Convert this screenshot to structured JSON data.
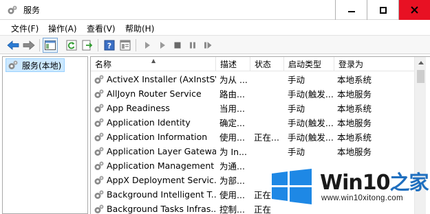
{
  "window": {
    "title": "服务",
    "accent": "#e81123"
  },
  "menu": [
    {
      "label": "文件(F)"
    },
    {
      "label": "操作(A)"
    },
    {
      "label": "查看(V)"
    },
    {
      "label": "帮助(H)"
    }
  ],
  "toolbar": {
    "icons": [
      "back-arrow-icon",
      "forward-arrow-icon",
      "show-console-tree-icon",
      "refresh-icon",
      "export-list-icon",
      "help-icon",
      "properties-icon",
      "start-service-icon",
      "start-service-alt-icon",
      "stop-service-icon",
      "pause-service-icon",
      "restart-service-icon"
    ]
  },
  "tree": {
    "items": [
      {
        "label": "服务(本地)"
      }
    ]
  },
  "list": {
    "columns": [
      {
        "label": "名称"
      },
      {
        "label": "描述"
      },
      {
        "label": "状态"
      },
      {
        "label": "启动类型"
      },
      {
        "label": "登录为"
      }
    ],
    "rows": [
      {
        "name": "ActiveX Installer (AxInstSV)",
        "desc": "为从 ...",
        "status": "",
        "startup": "手动",
        "logon": "本地系统"
      },
      {
        "name": "AllJoyn Router Service",
        "desc": "路由...",
        "status": "",
        "startup": "手动(触发...",
        "logon": "本地服务"
      },
      {
        "name": "App Readiness",
        "desc": "当用...",
        "status": "",
        "startup": "手动",
        "logon": "本地系统"
      },
      {
        "name": "Application Identity",
        "desc": "确定...",
        "status": "",
        "startup": "手动(触发...",
        "logon": "本地服务"
      },
      {
        "name": "Application Information",
        "desc": "使用...",
        "status": "正在...",
        "startup": "手动(触发...",
        "logon": "本地系统"
      },
      {
        "name": "Application Layer Gatewa...",
        "desc": "为 In...",
        "status": "",
        "startup": "手动",
        "logon": "本地服务"
      },
      {
        "name": "Application Management",
        "desc": "为通...",
        "status": "",
        "startup": "",
        "logon": ""
      },
      {
        "name": "AppX Deployment Servic...",
        "desc": "为部...",
        "status": "",
        "startup": "",
        "logon": ""
      },
      {
        "name": "Background Intelligent T...",
        "desc": "使用...",
        "status": "正在",
        "startup": "",
        "logon": ""
      },
      {
        "name": "Background Tasks Infras...",
        "desc": "控制...",
        "status": "正在",
        "startup": "",
        "logon": ""
      }
    ]
  },
  "watermark": {
    "brand": "Win10",
    "brand_suffix": "之家",
    "url": "www.win10xitong.com",
    "logo_color": "#1e88e5"
  }
}
